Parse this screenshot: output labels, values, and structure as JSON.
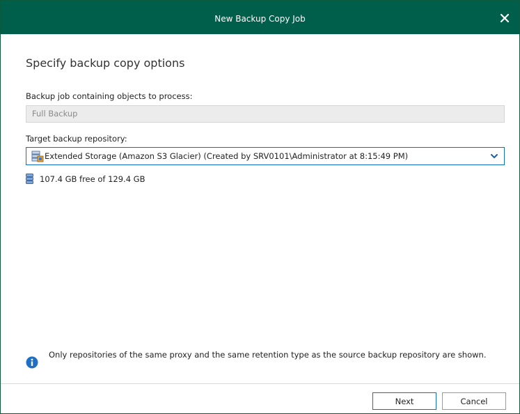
{
  "window": {
    "title": "New Backup Copy Job",
    "close_icon": "close-icon"
  },
  "page": {
    "heading": "Specify backup copy options"
  },
  "source_job": {
    "label": "Backup job containing objects to process:",
    "value": "Full Backup"
  },
  "target_repository": {
    "label": "Target backup repository:",
    "selected": "Extended Storage (Amazon S3 Glacier) (Created by SRV0101\\Administrator at 8:15:49 PM)",
    "icon": "repository-icon"
  },
  "capacity": {
    "text": "107.4 GB free of 129.4 GB",
    "icon": "database-icon"
  },
  "note": {
    "icon": "info-icon",
    "text": "Only repositories of the same proxy and the same retention type as the source backup repository are shown."
  },
  "buttons": {
    "next_label": "Next",
    "cancel_label": "Cancel"
  },
  "colors": {
    "titlebar": "#005f4b",
    "accent": "#0f6fc6",
    "info": "#1f6fc5"
  }
}
